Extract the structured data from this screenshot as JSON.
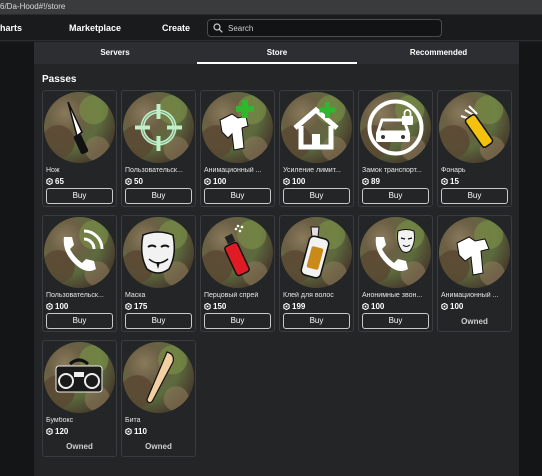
{
  "browser": {
    "url": "6/Da-Hood#!/store"
  },
  "nav": {
    "charts": "harts",
    "marketplace": "Marketplace",
    "create": "Create",
    "search_placeholder": "Search"
  },
  "tabs": [
    {
      "label": "Servers"
    },
    {
      "label": "Store"
    },
    {
      "label": "Recommended"
    }
  ],
  "section_title": "Passes",
  "labels": {
    "buy": "Buy",
    "owned": "Owned"
  },
  "passes": [
    {
      "name": "Нож",
      "price": "65",
      "icon": "knife-icon",
      "status": "buy"
    },
    {
      "name": "Пользовательск...",
      "price": "50",
      "icon": "crosshair-icon",
      "status": "buy"
    },
    {
      "name": "Анимационный ...",
      "price": "100",
      "icon": "animation-plus-icon",
      "status": "buy"
    },
    {
      "name": "Усиление лимит...",
      "price": "100",
      "icon": "house-plus-icon",
      "status": "buy"
    },
    {
      "name": "Замок транспорт...",
      "price": "89",
      "icon": "car-lock-icon",
      "status": "buy"
    },
    {
      "name": "Фонарь",
      "price": "15",
      "icon": "flashlight-icon",
      "status": "buy"
    },
    {
      "name": "Пользовательск...",
      "price": "100",
      "icon": "phone-icon",
      "status": "buy"
    },
    {
      "name": "Маска",
      "price": "175",
      "icon": "mask-icon",
      "status": "buy"
    },
    {
      "name": "Перцовый спрей",
      "price": "150",
      "icon": "pepper-spray-icon",
      "status": "buy"
    },
    {
      "name": "Клей для волос",
      "price": "199",
      "icon": "glue-icon",
      "status": "buy"
    },
    {
      "name": "Анонимные звон...",
      "price": "100",
      "icon": "anonymous-call-icon",
      "status": "buy"
    },
    {
      "name": "Анимационный ...",
      "price": "100",
      "icon": "animation-icon",
      "status": "owned"
    },
    {
      "name": "Бумбокс",
      "price": "120",
      "icon": "boombox-icon",
      "status": "owned"
    },
    {
      "name": "Бита",
      "price": "110",
      "icon": "bat-icon",
      "status": "owned"
    }
  ]
}
